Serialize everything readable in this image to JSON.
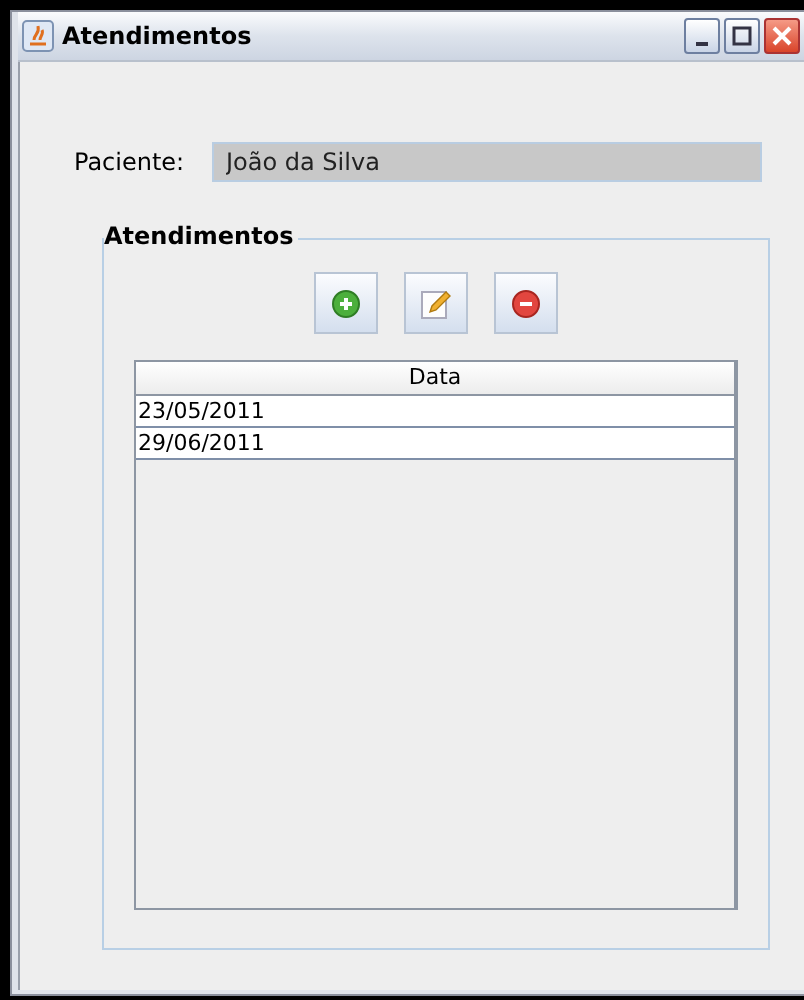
{
  "window": {
    "title": "Atendimentos"
  },
  "patient": {
    "label": "Paciente:",
    "value": "João da Silva"
  },
  "group": {
    "title": "Atendimentos"
  },
  "toolbar": [
    {
      "kind": "add"
    },
    {
      "kind": "edit"
    },
    {
      "kind": "remove"
    }
  ],
  "table": {
    "columns": [
      "Data"
    ],
    "rows": [
      [
        "23/05/2011"
      ],
      [
        "29/06/2011"
      ]
    ]
  }
}
